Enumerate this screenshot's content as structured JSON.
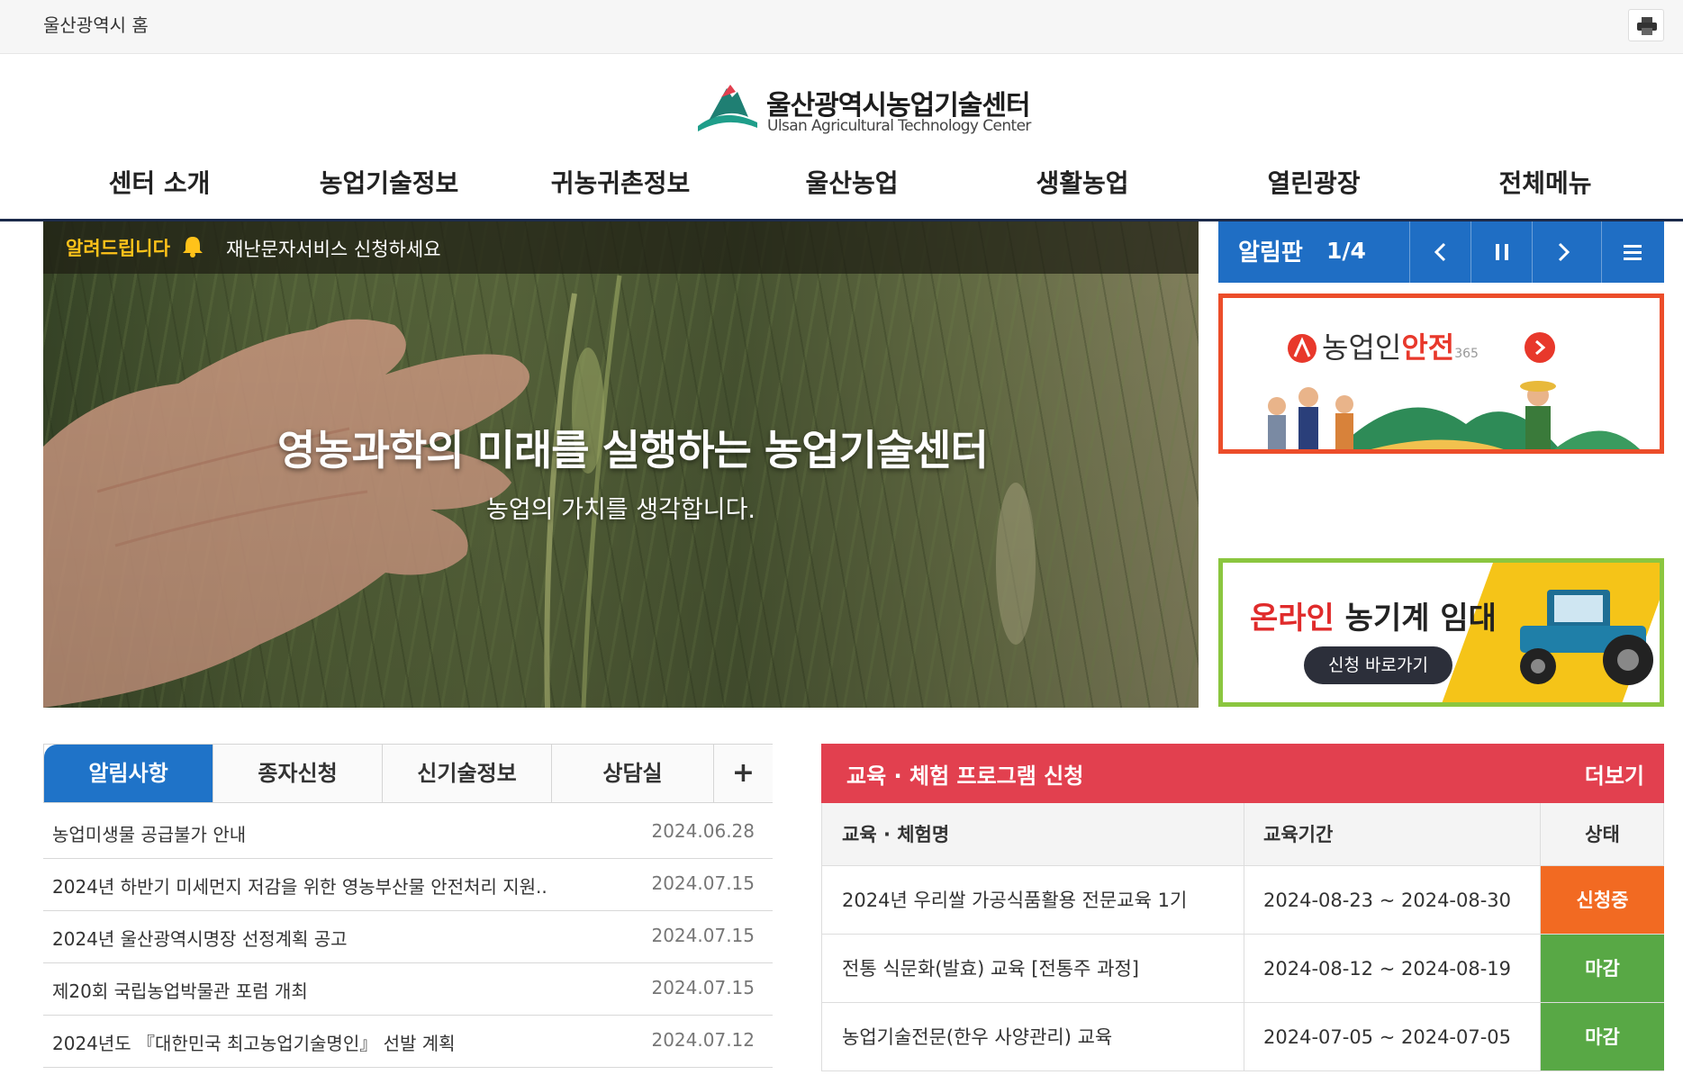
{
  "util": {
    "home_link": "울산광역시 홈"
  },
  "logo": {
    "ko": "울산광역시농업기술센터",
    "en": "Ulsan Agricultural Technology Center"
  },
  "gnb": [
    "센터 소개",
    "농업기술정보",
    "귀농귀촌정보",
    "울산농업",
    "생활농업",
    "열린광장",
    "전체메뉴"
  ],
  "notice_bar": {
    "label": "알려드립니다",
    "message": "재난문자서비스 신청하세요"
  },
  "hero": {
    "headline": "영농과학의 미래를 실행하는 농업기술센터",
    "sub": "농업의 가치를 생각합니다."
  },
  "board": {
    "title": "알림판",
    "pager": "1/4"
  },
  "banner_safety": {
    "brand_a": "농업인",
    "brand_b": "안전",
    "brand_c": "365"
  },
  "banner_machine": {
    "red": "온라인",
    "rest": " 농기계 임대",
    "button": "신청 바로가기"
  },
  "tabs": [
    "알림사항",
    "종자신청",
    "신기술정보",
    "상담실",
    "+"
  ],
  "notices": [
    {
      "title": "농업미생물 공급불가 안내",
      "date": "2024.06.28"
    },
    {
      "title": "2024년 하반기 미세먼지 저감을 위한 영농부산물 안전처리 지원..",
      "date": "2024.07.15"
    },
    {
      "title": "2024년 울산광역시명장 선정계획 공고",
      "date": "2024.07.15"
    },
    {
      "title": "제20회 국립농업박물관 포럼 개최",
      "date": "2024.07.15"
    },
    {
      "title": "2024년도 『대한민국 최고농업기술명인』 선발 계획",
      "date": "2024.07.12"
    }
  ],
  "program": {
    "title": "교육 · 체험 프로그램 신청",
    "more": "더보기",
    "headers": [
      "교육 · 체험명",
      "교육기간",
      "상태"
    ],
    "rows": [
      {
        "name": "2024년 우리쌀 가공식품활용 전문교육 1기",
        "period": "2024-08-23 ~ 2024-08-30",
        "status": "신청중"
      },
      {
        "name": "전통 식문화(발효) 교육 [전통주 과정]",
        "period": "2024-08-12 ~ 2024-08-19",
        "status": "마감"
      },
      {
        "name": "농업기술전문(한우 사양관리) 교육",
        "period": "2024-07-05 ~ 2024-07-05",
        "status": "마감"
      }
    ]
  },
  "colors": {
    "board_blue": "#1f6ec4",
    "program_red": "#e2404f",
    "status_open": "#f26a22",
    "status_closed": "#58a845",
    "notice_yellow": "#ffc21a"
  }
}
